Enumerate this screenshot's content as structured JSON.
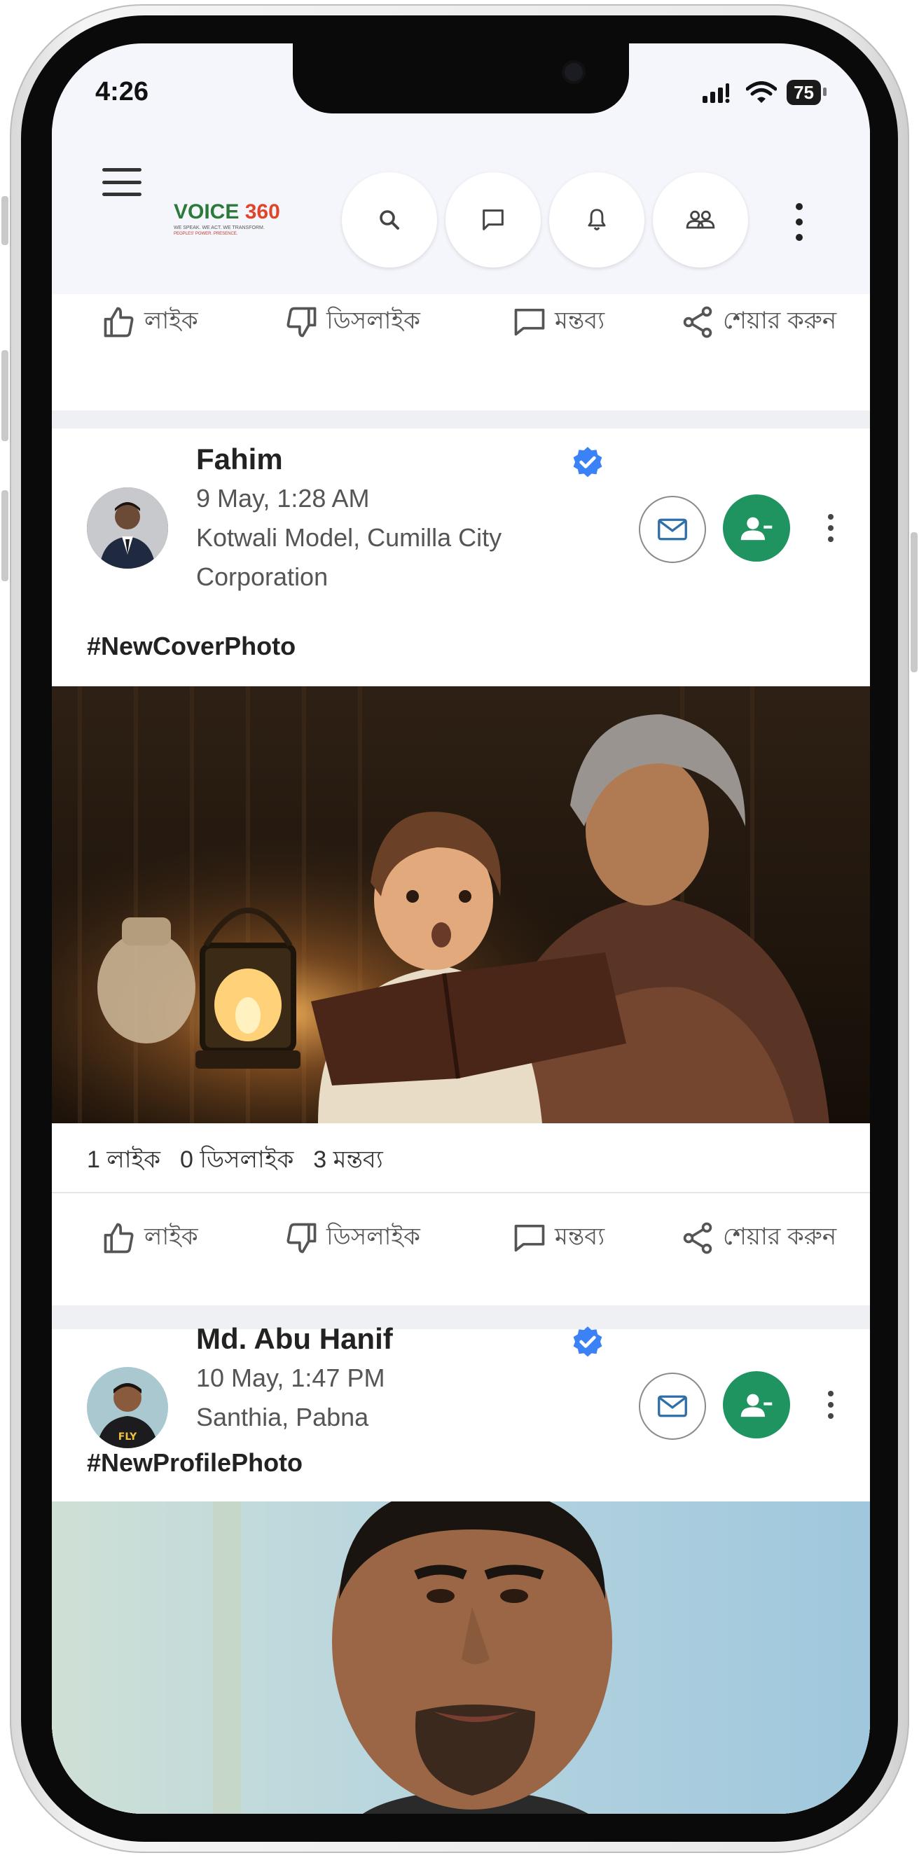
{
  "status_bar": {
    "time": "4:26",
    "battery": "75"
  },
  "header": {
    "logo": {
      "text_main": "VOICE",
      "text_num": "360",
      "tagline": "WE SPEAK. WE ACT. WE TRANSFORM.",
      "tagline2": "PEOPLES' POWER. PRESENCE."
    },
    "icons": [
      "menu-icon",
      "search-icon",
      "chat-icon",
      "bell-icon",
      "people-icon",
      "more-vert-icon"
    ]
  },
  "actions": {
    "like": "লাইক",
    "dislike": "ডিসলাইক",
    "comment": "মন্তব্য",
    "share": "শেয়ার করুন"
  },
  "posts": [
    {
      "author": "Fahim",
      "time": "9 May, 1:28 AM",
      "location_line1": "Kotwali Model, Cumilla City",
      "location_line2": "Corporation",
      "hashtag": "#NewCoverPhoto",
      "counts": {
        "likes": "1 লাইক",
        "dislikes": "0 ডিসলাইক",
        "comments": "3 মন্তব্য"
      }
    },
    {
      "author": "Md. Abu Hanif",
      "time": "10 May, 1:47 PM",
      "location_line1": "Santhia, Pabna",
      "hashtag": "#NewProfilePhoto"
    }
  ],
  "colors": {
    "accent_green": "#1f9460",
    "verified_blue": "#3b82f6"
  }
}
